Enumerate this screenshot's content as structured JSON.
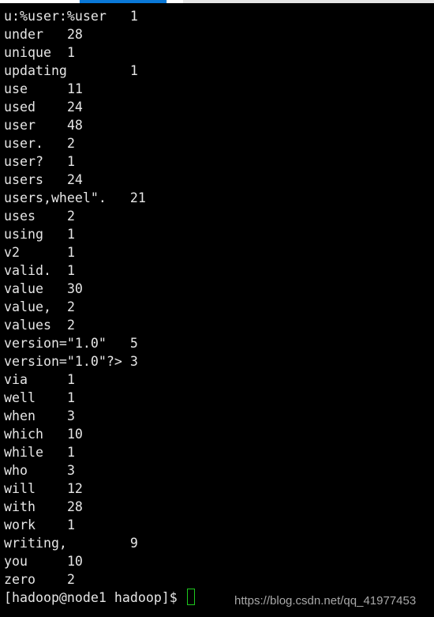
{
  "output_lines": [
    {
      "word": "u:%user:%user",
      "count": "1"
    },
    {
      "word": "under",
      "count": "28"
    },
    {
      "word": "unique",
      "count": "1"
    },
    {
      "word": "updating",
      "count": "1"
    },
    {
      "word": "use",
      "count": "11"
    },
    {
      "word": "used",
      "count": "24"
    },
    {
      "word": "user",
      "count": "48"
    },
    {
      "word": "user.",
      "count": "2"
    },
    {
      "word": "user?",
      "count": "1"
    },
    {
      "word": "users",
      "count": "24"
    },
    {
      "word": "users,wheel\".",
      "count": "21"
    },
    {
      "word": "uses",
      "count": "2"
    },
    {
      "word": "using",
      "count": "1"
    },
    {
      "word": "v2",
      "count": "1"
    },
    {
      "word": "valid.",
      "count": "1"
    },
    {
      "word": "value",
      "count": "30"
    },
    {
      "word": "value,",
      "count": "2"
    },
    {
      "word": "values",
      "count": "2"
    },
    {
      "word": "version=\"1.0\"",
      "count": "5"
    },
    {
      "word": "version=\"1.0\"?>",
      "count": "3"
    },
    {
      "word": "via",
      "count": "1"
    },
    {
      "word": "well",
      "count": "1"
    },
    {
      "word": "when",
      "count": "3"
    },
    {
      "word": "which",
      "count": "10"
    },
    {
      "word": "while",
      "count": "1"
    },
    {
      "word": "who",
      "count": "3"
    },
    {
      "word": "will",
      "count": "12"
    },
    {
      "word": "with",
      "count": "28"
    },
    {
      "word": "work",
      "count": "1"
    },
    {
      "word": "writing,",
      "count": "9"
    },
    {
      "word": "you",
      "count": "10"
    },
    {
      "word": "zero",
      "count": "2"
    }
  ],
  "prompt": "[hadoop@node1 hadoop]$ ",
  "watermark": "https://blog.csdn.net/qq_41977453",
  "colors": {
    "background": "#000000",
    "text": "#e6e6e6",
    "cursor": "#1ec81e",
    "tab_active": "#0a78d7"
  }
}
